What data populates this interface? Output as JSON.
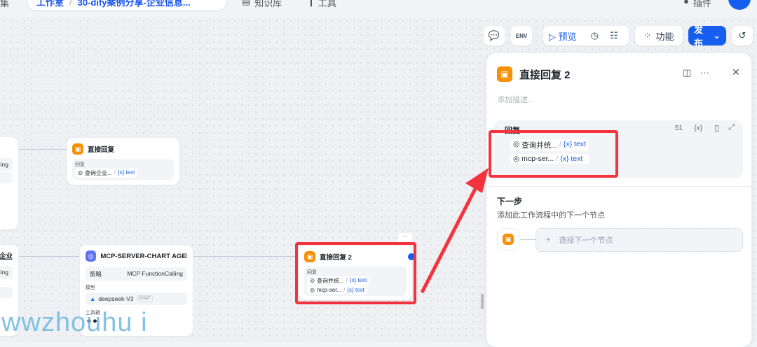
{
  "header": {
    "left_cut": "集",
    "breadcrumb_root": "工作室",
    "breadcrumb_app": "30-dify案例分享-企业信息...",
    "nav_knowledge": "知识库",
    "nav_tools": "工具",
    "nav_plugins": "插件"
  },
  "toolbar": {
    "preview": "预览",
    "features": "功能",
    "publish": "发布",
    "env": "ENV"
  },
  "nodes": {
    "reply1": {
      "title": "直接回复",
      "label": "回复",
      "chip": "查询企业...",
      "var": "{x} text"
    },
    "agent": {
      "title": "MCP-SERVER-CHART AGEN",
      "strategy_label": "策略",
      "strategy": "MCP FunctionCalling",
      "model_label": "模型",
      "model": "deepseek-V3",
      "model_tag": "CHAT",
      "tools_label": "工具箱"
    },
    "reply2": {
      "title": "直接回复 2",
      "label": "回复",
      "chips": [
        {
          "name": "查询并统...",
          "var": "{x} text"
        },
        {
          "name": "mcp-ser...",
          "var": "{x} text"
        }
      ]
    },
    "left_partial": {
      "row": "lling",
      "title_cut": "企业"
    }
  },
  "panel": {
    "title": "直接回复 2",
    "desc_placeholder": "添加描述...",
    "reply_label": "回复",
    "count": "51",
    "var_btn": "{x}",
    "chips": [
      {
        "name": "查询并统...",
        "var": "{x} text"
      },
      {
        "name": "mcp-ser...",
        "var": "{x} text"
      }
    ],
    "next_title": "下一步",
    "next_desc": "添加此工作流程中的下一个节点",
    "next_select": "选择下一个节点"
  },
  "watermark": "wwzhouhu i",
  "colors": {
    "accent": "#155eef",
    "annotation": "#f5333f",
    "node_orange": "#f79009"
  }
}
